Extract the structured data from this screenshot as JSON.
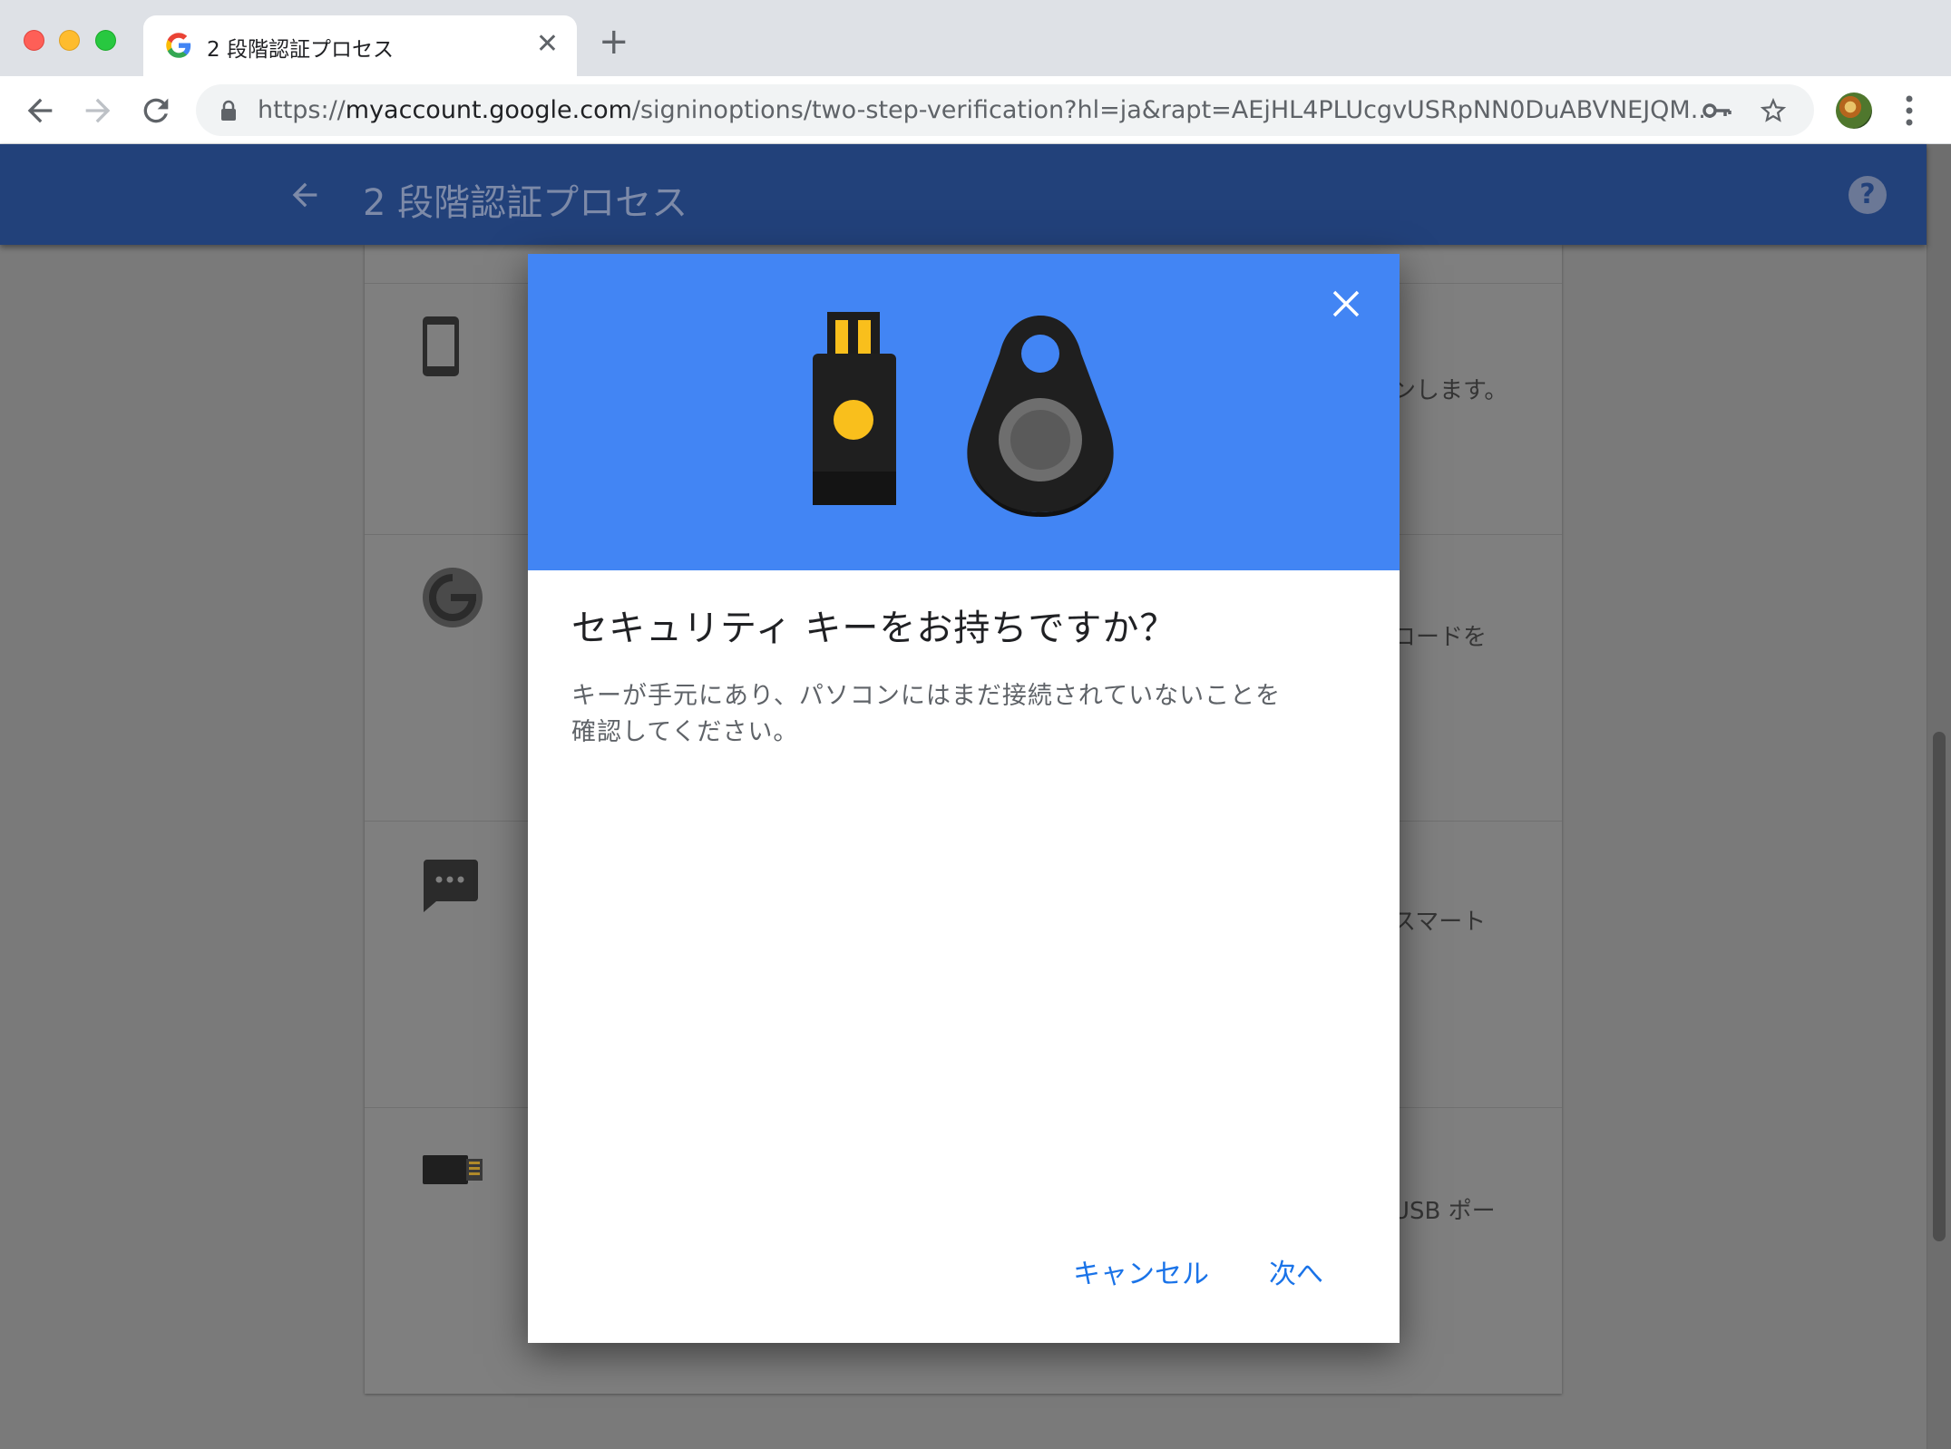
{
  "browser": {
    "tab_title": "2 段階認証プロセス",
    "url_scheme": "https://",
    "url_host": "myaccount.google.com",
    "url_path": "/signinoptions/two-step-verification?hl=ja&rapt=AEjHL4PLUcgvUSRpNN0DuABVNEJQM..."
  },
  "appbar": {
    "title": "2 段階認証プロセス"
  },
  "background_rows": [
    {
      "icon": "phone-icon",
      "text": "ンします。"
    },
    {
      "icon": "authenticator-icon",
      "text": "コードを"
    },
    {
      "icon": "sms-icon",
      "text": "スマート"
    },
    {
      "icon": "usb-key-icon",
      "text": "USB ポー"
    }
  ],
  "dialog": {
    "title": "セキュリティ キーをお持ちですか？",
    "body_line1": "キーが手元にあり、パソコンにはまだ接続されていないことを",
    "body_line2": "確認してください。",
    "cancel_label": "キャンセル",
    "next_label": "次へ"
  },
  "colors": {
    "appbar": "#22417a",
    "dialog_hero": "#4285f4",
    "accent_button": "#1a73e8",
    "overlay_gray": "#7a7a7a"
  }
}
